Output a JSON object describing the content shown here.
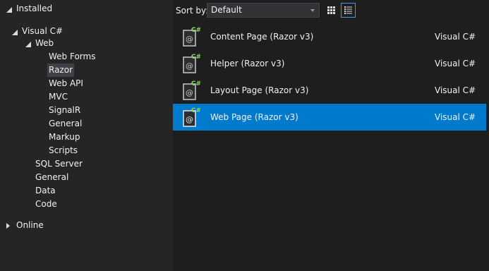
{
  "tree": {
    "installed": "Installed",
    "visual_csharp": "Visual C#",
    "web": "Web",
    "web_children": [
      "Web Forms",
      "Razor",
      "Web API",
      "MVC",
      "SignalR",
      "General",
      "Markup",
      "Scripts"
    ],
    "csharp_children": [
      "SQL Server",
      "General",
      "Data",
      "Code"
    ],
    "online": "Online",
    "selected": "Razor"
  },
  "sort": {
    "label": "Sort by:",
    "value": "Default"
  },
  "view": {
    "grid_icon": "grid-view-icon",
    "list_icon": "list-view-icon",
    "active": "list"
  },
  "templates": [
    {
      "name": "Content Page (Razor v3)",
      "language": "Visual C#",
      "icon": "csharp-razor-file-icon"
    },
    {
      "name": "Helper (Razor v3)",
      "language": "Visual C#",
      "icon": "csharp-razor-file-icon"
    },
    {
      "name": "Layout Page (Razor v3)",
      "language": "Visual C#",
      "icon": "csharp-razor-file-icon"
    },
    {
      "name": "Web Page (Razor v3)",
      "language": "Visual C#",
      "icon": "csharp-razor-file-icon",
      "selected": true
    }
  ],
  "colors": {
    "selection": "#007acc",
    "tree_selection": "#3f3f46",
    "csharp_badge": "#8bd36b"
  }
}
